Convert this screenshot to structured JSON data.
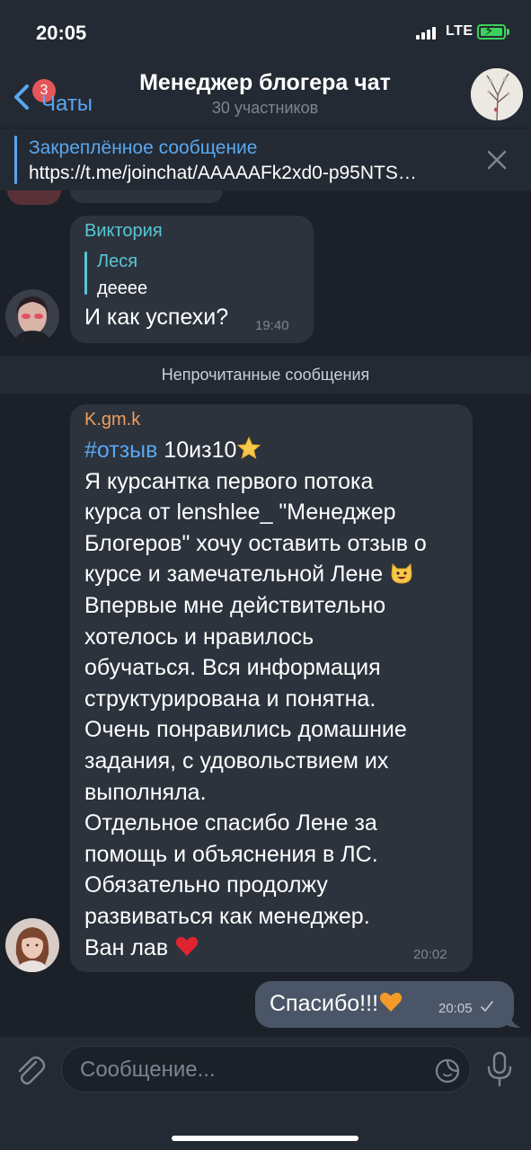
{
  "status_bar": {
    "time": "20:05",
    "network": "LTE"
  },
  "header": {
    "back_label": "Чаты",
    "unread_badge": "3",
    "title": "Менеджер блогера чат",
    "subtitle": "30 участников"
  },
  "pinned": {
    "title": "Закреплённое сообщение",
    "text": "https://t.me/joinchat/AAAAAFk2xd0-p95NTS…"
  },
  "messages": [
    {
      "sender": "Виктория",
      "reply_name": "Леся",
      "reply_text": "деeee",
      "text": "И как успехи?",
      "time": "19:40"
    },
    {
      "sender": "K.gm.k",
      "hashtag": "#отзыв",
      "line1_rest": "10из10",
      "lines": [
        "Я курсантка первого потока",
        "курса от lenshlee_ \"Менеджер",
        "Блогеров\" хочу оставить отзыв о",
        "курсе и замечательной Лене",
        "Впервые мне действительно",
        "хотелось и нравилось",
        "обучаться. Вся информация",
        "структурирована и понятна.",
        "Очень понравились домашние",
        "задания, с удовольствием их",
        "выполняла.",
        "Отдельное спасибо Лене за",
        "помощь и объяснения в ЛС.",
        "Обязательно продолжу",
        "развиваться как менеджер.",
        "Ван лав"
      ],
      "time": "20:02"
    },
    {
      "text": "Спасибо!!!",
      "time": "20:05",
      "outgoing": true
    }
  ],
  "unread_separator": "Непрочитанные сообщения",
  "input": {
    "placeholder": "Сообщение..."
  },
  "colors": {
    "background": "#1c2129",
    "bar": "#242a33",
    "bubble_in": "#2c333d",
    "bubble_out": "#4a5667",
    "accent": "#59a7ef",
    "badge": "#e5565a"
  }
}
